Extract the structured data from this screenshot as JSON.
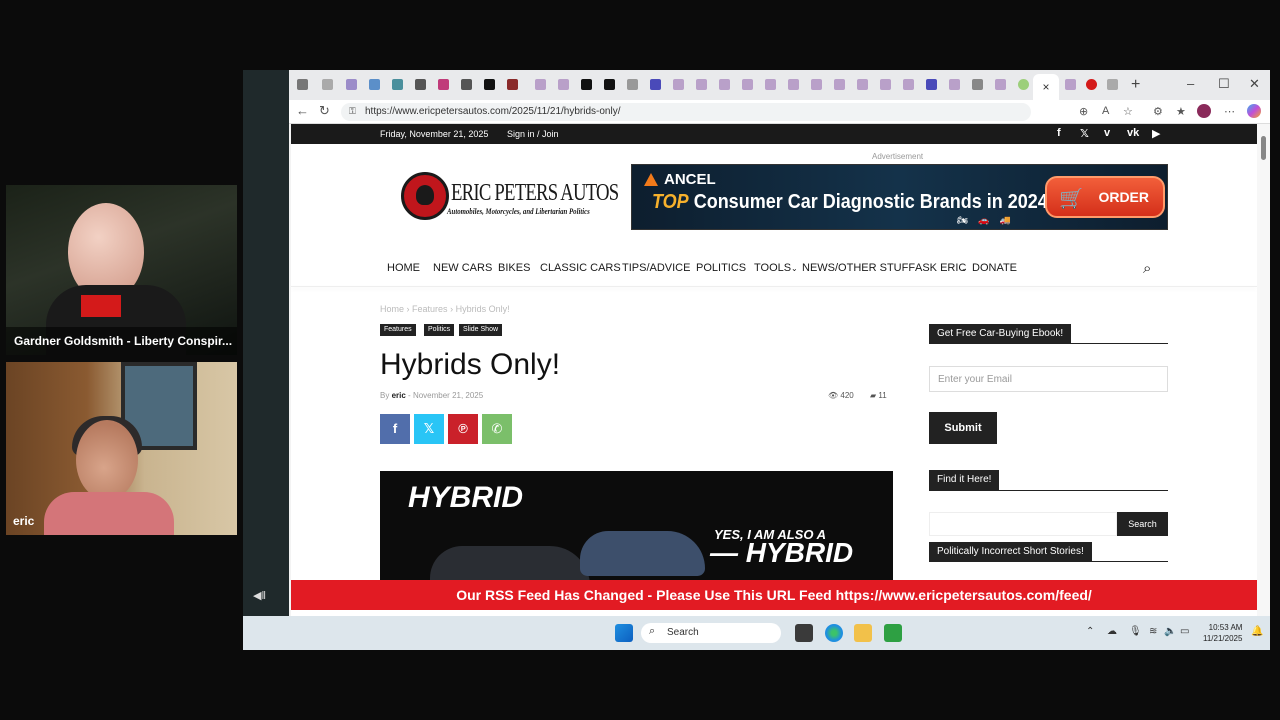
{
  "call": {
    "participant1": "Gardner Goldsmith - Liberty Conspir...",
    "participant2": "eric"
  },
  "browser": {
    "url": "https://www.ericpetersautos.com/2025/11/21/hybrids-only/",
    "close_tab": "×",
    "new_tab": "+"
  },
  "site": {
    "topbar": {
      "date": "Friday, November 21, 2025",
      "sign_in": "Sign in / Join"
    },
    "ad_label": "Advertisement",
    "logo": {
      "name": "ERIC PETERS AUTOS",
      "tagline": "Automobiles, Motorcycles, and Libertarian Politics"
    },
    "banner": {
      "brand": "ANCEL",
      "headline_top": "TOP",
      "headline": "Consumer Car Diagnostic Brands in 2024",
      "button": "ORDER"
    },
    "nav": [
      "HOME",
      "NEW CARS",
      "BIKES",
      "CLASSIC CARS",
      "TIPS/ADVICE",
      "POLITICS",
      "TOOLS",
      "NEWS/OTHER STUFF",
      "ASK ERIC",
      "DONATE"
    ],
    "breadcrumb": [
      "Home",
      "Features",
      "Hybrids Only!"
    ],
    "categories": [
      "Features",
      "Politics",
      "Slide Show"
    ],
    "article": {
      "title": "Hybrids Only!",
      "by": "By",
      "author": "eric",
      "date": "November 21, 2025",
      "views": "420",
      "comments": "11"
    },
    "hero": {
      "line1": "HYBRID",
      "line2": "YES, I AM ALSO A",
      "line3": "— HYBRID"
    },
    "sidebar": {
      "ebook_heading": "Get Free Car-Buying Ebook!",
      "email_placeholder": "Enter your Email",
      "submit": "Submit",
      "find_heading": "Find it Here!",
      "search_button": "Search",
      "stories_heading": "Politically Incorrect Short Stories!"
    },
    "rss_banner": "Our RSS Feed Has Changed - Please Use This URL Feed https://www.ericpetersautos.com/feed/"
  },
  "taskbar": {
    "search": "Search",
    "time": "10:53 AM",
    "date": "11/21/2025"
  },
  "colors": {
    "accent_red": "#e21b23",
    "dark": "#222222",
    "order_orange": "#f25f3a"
  }
}
